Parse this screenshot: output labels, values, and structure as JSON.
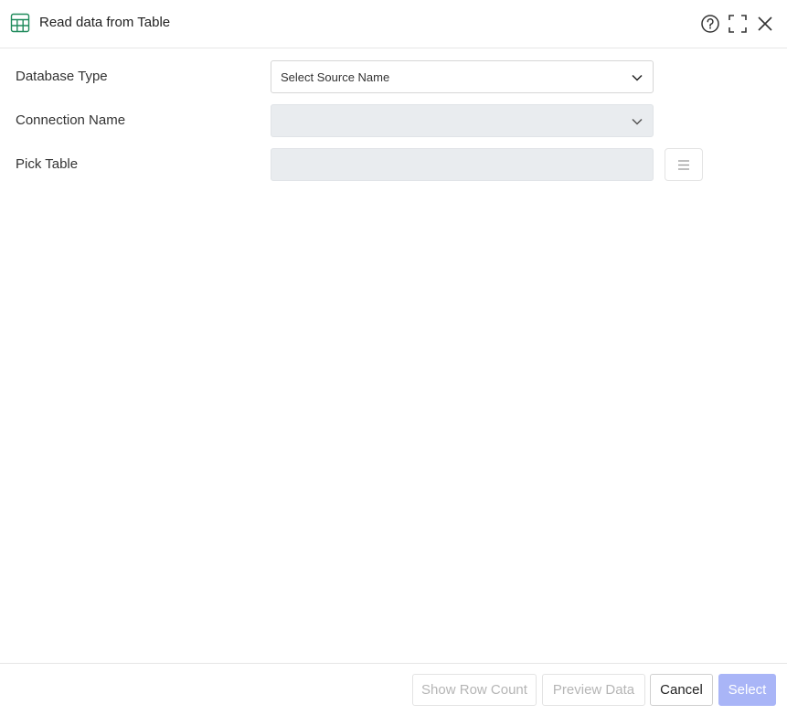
{
  "dialog": {
    "title": "Read data from Table",
    "icons": {
      "title": "table-icon",
      "help": "help-icon",
      "expand": "expand-icon",
      "close": "close-icon"
    }
  },
  "form": {
    "database_type": {
      "label": "Database Type",
      "value": "Select Source Name",
      "icon": "chevron-down-icon"
    },
    "connection_name": {
      "label": "Connection Name",
      "value": "",
      "disabled": true,
      "icon": "chevron-down-icon"
    },
    "pick_table": {
      "label": "Pick Table",
      "value": "",
      "disabled": true,
      "button_icon": "list-icon"
    }
  },
  "footer": {
    "show_row_count": "Show Row Count",
    "preview_data": "Preview Data",
    "cancel": "Cancel",
    "select": "Select"
  },
  "colors": {
    "accent_green": "#1f8a5b",
    "select_button_disabled": "#a9b5f7",
    "disabled_field": "#e9ecef"
  }
}
